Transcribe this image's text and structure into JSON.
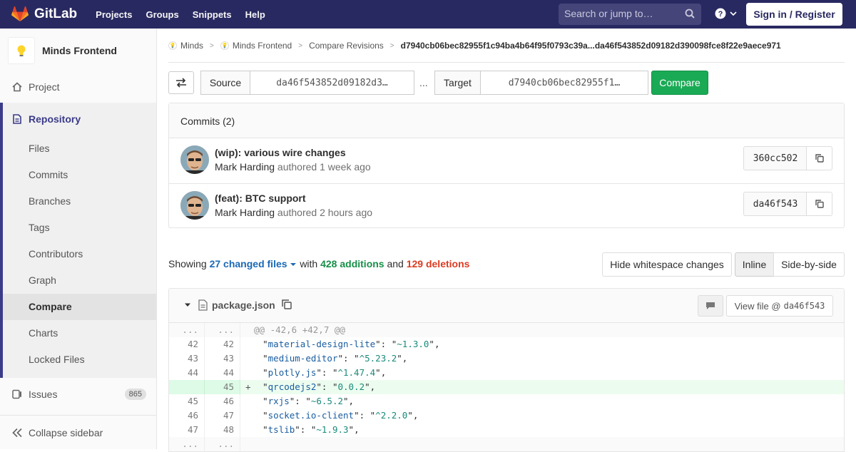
{
  "navbar": {
    "brand": "GitLab",
    "links": [
      "Projects",
      "Groups",
      "Snippets",
      "Help"
    ],
    "search_placeholder": "Search or jump to…",
    "sign_in": "Sign in / Register"
  },
  "sidebar": {
    "project_name": "Minds Frontend",
    "project": "Project",
    "repository": "Repository",
    "repo_items": [
      "Files",
      "Commits",
      "Branches",
      "Tags",
      "Contributors",
      "Graph",
      "Compare",
      "Charts",
      "Locked Files"
    ],
    "issues": "Issues",
    "issues_count": "865",
    "collapse": "Collapse sidebar"
  },
  "breadcrumb": {
    "items": [
      "Minds",
      "Minds Frontend",
      "Compare Revisions"
    ],
    "current": "d7940cb06bec82955f1c94ba4b64f95f0793c39a...da46f543852d09182d390098fce8f22e9aece971"
  },
  "compare": {
    "source_label": "Source",
    "source_value": "da46f543852d09182d3…",
    "separator": "...",
    "target_label": "Target",
    "target_value": "d7940cb06bec82955f1…",
    "button": "Compare"
  },
  "commits": {
    "header": "Commits (2)",
    "rows": [
      {
        "title": "(wip): various wire changes",
        "author": "Mark Harding",
        "meta": "authored 1 week ago",
        "sha": "360cc502"
      },
      {
        "title": "(feat): BTC support",
        "author": "Mark Harding",
        "meta": "authored 2 hours ago",
        "sha": "da46f543"
      }
    ]
  },
  "summary": {
    "showing": "Showing",
    "files": "27 changed files",
    "with": "with",
    "additions": "428 additions",
    "and": "and",
    "deletions": "129 deletions",
    "hide_ws": "Hide whitespace changes",
    "inline": "Inline",
    "side_by_side": "Side-by-side"
  },
  "file": {
    "name": "package.json",
    "view_label": "View file @",
    "view_sha": "da46f543"
  },
  "diff": {
    "hunk": "@@ -42,6 +42,7 @@",
    "ellipsis": "...",
    "lines": [
      {
        "old": "42",
        "new": "42",
        "key": "material-design-lite",
        "val": "~1.3.0",
        "added": false
      },
      {
        "old": "43",
        "new": "43",
        "key": "medium-editor",
        "val": "^5.23.2",
        "added": false
      },
      {
        "old": "44",
        "new": "44",
        "key": "plotly.js",
        "val": "^1.47.4",
        "added": false
      },
      {
        "old": "",
        "new": "45",
        "key": "qrcodejs2",
        "val": "0.0.2",
        "added": true
      },
      {
        "old": "45",
        "new": "46",
        "key": "rxjs",
        "val": "~6.5.2",
        "added": false
      },
      {
        "old": "46",
        "new": "47",
        "key": "socket.io-client",
        "val": "^2.2.0",
        "added": false
      },
      {
        "old": "47",
        "new": "48",
        "key": "tslib",
        "val": "~1.9.3",
        "added": false
      }
    ]
  }
}
